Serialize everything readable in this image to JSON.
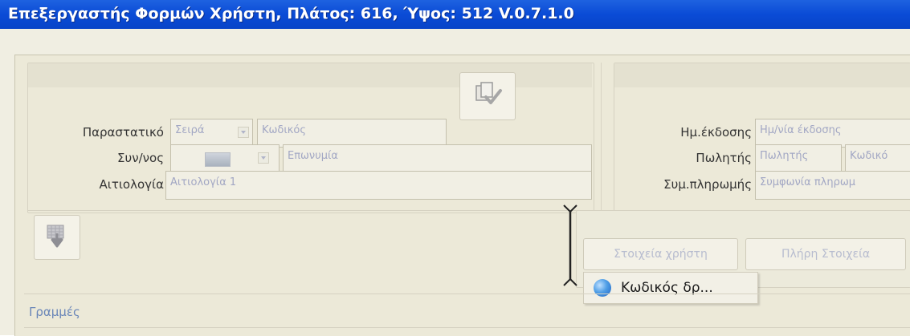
{
  "window": {
    "title": "Επεξεργαστής Φορμών Χρήστη, Πλάτος: 616, Ύψος: 512 V.0.7.1.0"
  },
  "form": {
    "left": {
      "rows": [
        {
          "label": "Παραστατικό",
          "fields": [
            {
              "placeholder": "Σειρά",
              "type": "combo"
            },
            {
              "placeholder": "Κωδικός",
              "type": "text"
            }
          ]
        },
        {
          "label": "Συν/νος",
          "fields": [
            {
              "placeholder": "",
              "type": "combo-image"
            },
            {
              "placeholder": "Επωνυμία",
              "type": "text"
            }
          ]
        },
        {
          "label": "Αιτιολογία",
          "fields": [
            {
              "placeholder": "Αιτιολογία 1",
              "type": "text"
            }
          ]
        }
      ]
    },
    "right": {
      "rows": [
        {
          "label": "Ημ.έκδοσης",
          "fields": [
            {
              "placeholder": "Ημ/νία έκδοσης"
            }
          ]
        },
        {
          "label": "Πωλητής",
          "fields": [
            {
              "placeholder": "Πωλητής"
            },
            {
              "placeholder": "Κωδικό"
            }
          ]
        },
        {
          "label": "Συμ.πληρωμής",
          "fields": [
            {
              "placeholder": "Συμφωνία πληρωμ"
            }
          ]
        }
      ]
    },
    "buttons": {
      "user_details": "Στοιχεία χρήστη",
      "full_details": "Πλήρη Στοιχεία"
    },
    "section": {
      "lines_label": "Γραμμές"
    },
    "tooltip": {
      "text": "Κωδικός δρ..."
    }
  },
  "icons": {
    "copy_check": "copy-check-icon",
    "download": "download-icon",
    "blue_dot": "blue-dot-icon",
    "resize_cursor": "resize-cursor-icon"
  },
  "colors": {
    "titlebar": "#0a4bd6",
    "panel": "#ece9d8",
    "disabled_text": "#a2a7c4",
    "section_text": "#6a86b8"
  }
}
